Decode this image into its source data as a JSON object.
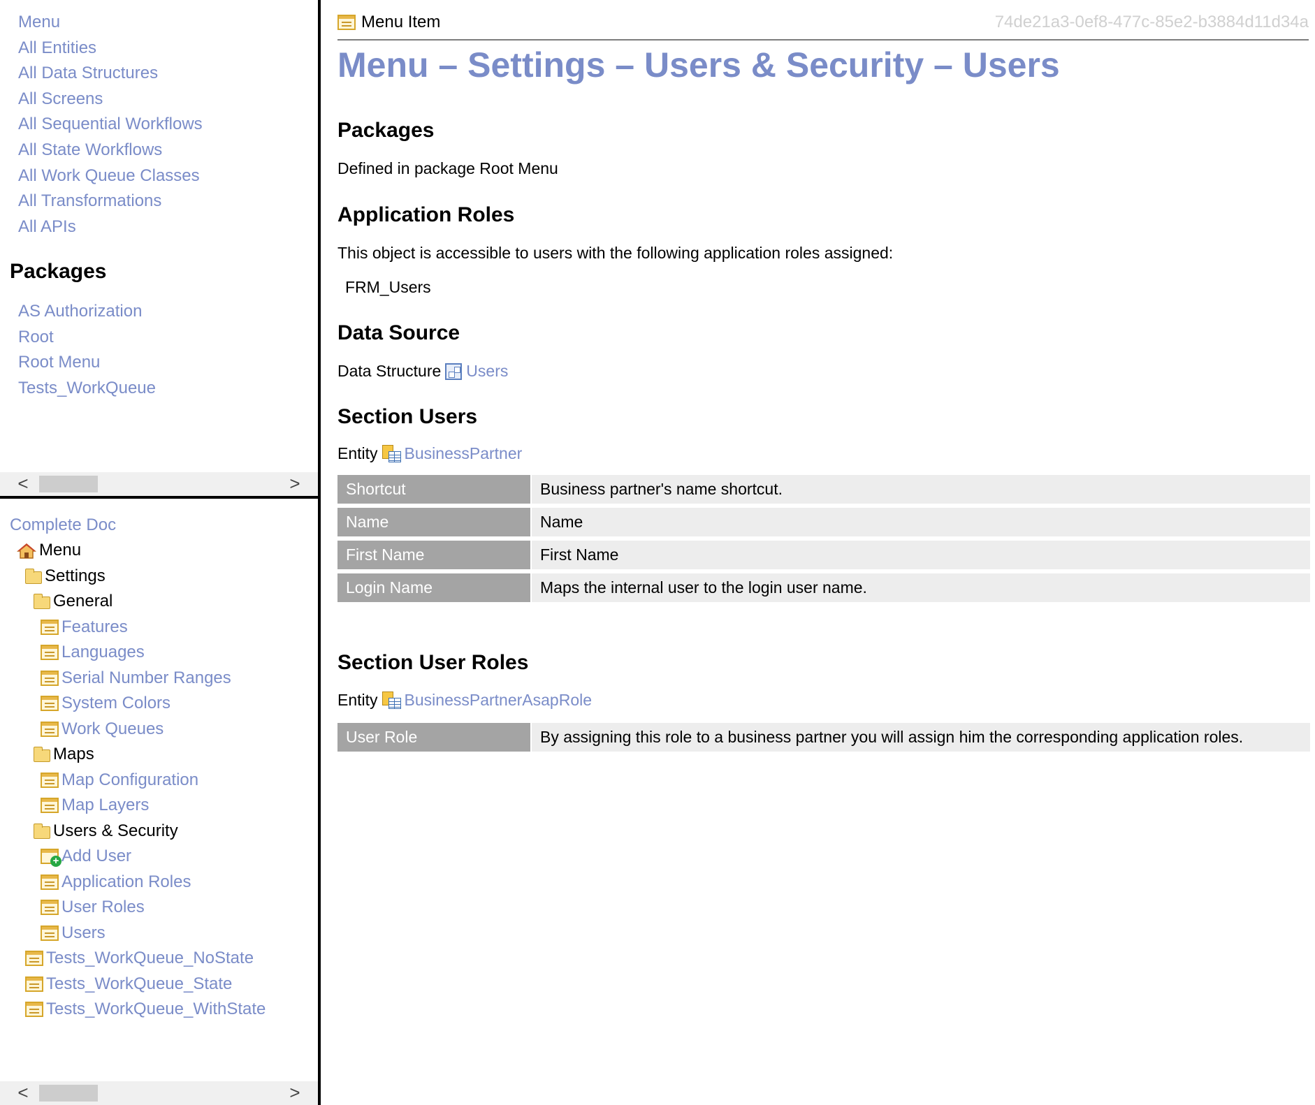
{
  "left_top": {
    "links": [
      "Menu",
      "All Entities",
      "All Data Structures",
      "All Screens",
      "All Sequential Workflows",
      "All State Workflows",
      "All Work Queue Classes",
      "All Transformations",
      "All APIs"
    ],
    "packages_heading": "Packages",
    "packages": [
      "AS Authorization",
      "Root",
      "Root Menu",
      "Tests_WorkQueue"
    ]
  },
  "left_bottom": {
    "complete_doc": "Complete Doc",
    "tree": [
      {
        "label": "Menu",
        "icon": "home-icon",
        "kind": "home",
        "depth": 0
      },
      {
        "label": "Settings",
        "icon": "folder-icon",
        "kind": "folder",
        "depth": 1
      },
      {
        "label": "General",
        "icon": "folder-icon",
        "kind": "folder",
        "depth": 2
      },
      {
        "label": "Features",
        "icon": "menu-page-icon",
        "kind": "page",
        "depth": 3
      },
      {
        "label": "Languages",
        "icon": "menu-page-icon",
        "kind": "page",
        "depth": 3
      },
      {
        "label": "Serial Number Ranges",
        "icon": "menu-page-icon",
        "kind": "page",
        "depth": 3
      },
      {
        "label": "System Colors",
        "icon": "menu-page-icon",
        "kind": "page",
        "depth": 3
      },
      {
        "label": "Work Queues",
        "icon": "menu-page-icon",
        "kind": "page",
        "depth": 3
      },
      {
        "label": "Maps",
        "icon": "folder-icon",
        "kind": "folder",
        "depth": 2
      },
      {
        "label": "Map Configuration",
        "icon": "menu-page-icon",
        "kind": "page",
        "depth": 3
      },
      {
        "label": "Map Layers",
        "icon": "menu-page-icon",
        "kind": "page",
        "depth": 3
      },
      {
        "label": "Users & Security",
        "icon": "folder-icon",
        "kind": "folder",
        "depth": 2
      },
      {
        "label": "Add User",
        "icon": "add-page-icon",
        "kind": "page",
        "depth": 3
      },
      {
        "label": "Application Roles",
        "icon": "menu-page-icon",
        "kind": "page",
        "depth": 3
      },
      {
        "label": "User Roles",
        "icon": "menu-page-icon",
        "kind": "page",
        "depth": 3
      },
      {
        "label": "Users",
        "icon": "menu-page-icon",
        "kind": "page",
        "depth": 3
      },
      {
        "label": "Tests_WorkQueue_NoState",
        "icon": "menu-page-icon",
        "kind": "page",
        "depth": 1
      },
      {
        "label": "Tests_WorkQueue_State",
        "icon": "menu-page-icon",
        "kind": "page",
        "depth": 1
      },
      {
        "label": "Tests_WorkQueue_WithState",
        "icon": "menu-page-icon",
        "kind": "page",
        "depth": 1
      }
    ]
  },
  "main": {
    "type_label": "Menu Item",
    "guid": "74de21a3-0ef8-477c-85e2-b3884d11d34a",
    "title": "Menu – Settings – Users & Security – Users",
    "packages": {
      "heading": "Packages",
      "text": "Defined in package Root Menu"
    },
    "app_roles": {
      "heading": "Application Roles",
      "text": "This object is accessible to users with the following application roles assigned:",
      "roles": [
        "FRM_Users"
      ]
    },
    "data_source": {
      "heading": "Data Source",
      "prefix": "Data Structure",
      "link": "Users"
    },
    "section_users": {
      "heading": "Section Users",
      "entity_prefix": "Entity",
      "entity": "BusinessPartner",
      "fields": [
        {
          "name": "Shortcut",
          "desc": "Business partner's name shortcut."
        },
        {
          "name": "Name",
          "desc": "Name"
        },
        {
          "name": "First Name",
          "desc": "First Name"
        },
        {
          "name": "Login Name",
          "desc": "Maps the internal user to the login user name."
        }
      ]
    },
    "section_user_roles": {
      "heading": "Section User Roles",
      "entity_prefix": "Entity",
      "entity": "BusinessPartnerAsapRole",
      "fields": [
        {
          "name": "User Role",
          "desc": "By assigning this role to a business partner you will assign him the corresponding application roles."
        }
      ]
    }
  },
  "scroll": {
    "left": "<",
    "right": ">"
  }
}
